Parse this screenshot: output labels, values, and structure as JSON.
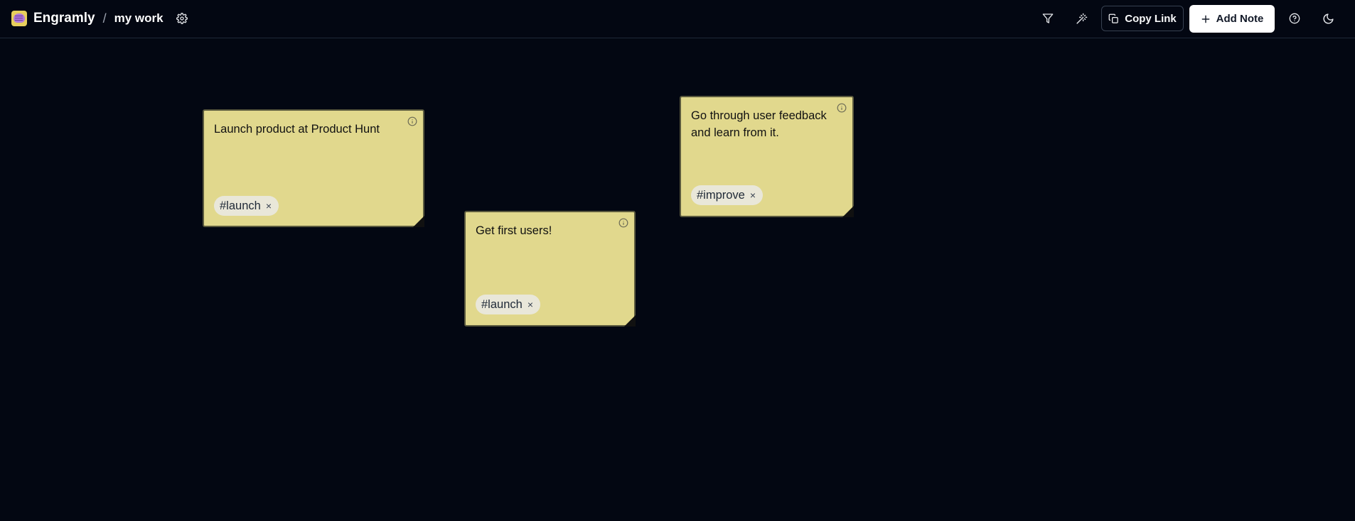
{
  "header": {
    "app_name": "Engramly",
    "separator": "/",
    "workspace": "my work",
    "settings_icon": "gear-icon",
    "filter_icon": "filter-icon",
    "magic_icon": "magic-wand-icon",
    "copy_link_label": "Copy Link",
    "add_note_label": "Add Note",
    "help_icon": "help-circle-icon",
    "theme_icon": "moon-icon"
  },
  "notes": [
    {
      "text": "Launch product at Product Hunt",
      "tag": "#launch",
      "remove": "×"
    },
    {
      "text": "Get first users!",
      "tag": "#launch",
      "remove": "×"
    },
    {
      "text": "Go through user feedback and learn from it.",
      "tag": "#improve",
      "remove": "×"
    }
  ],
  "colors": {
    "background": "#030712",
    "note": "#e1d88d",
    "tag": "#e9e7d9",
    "primary_button": "#ffffff"
  }
}
